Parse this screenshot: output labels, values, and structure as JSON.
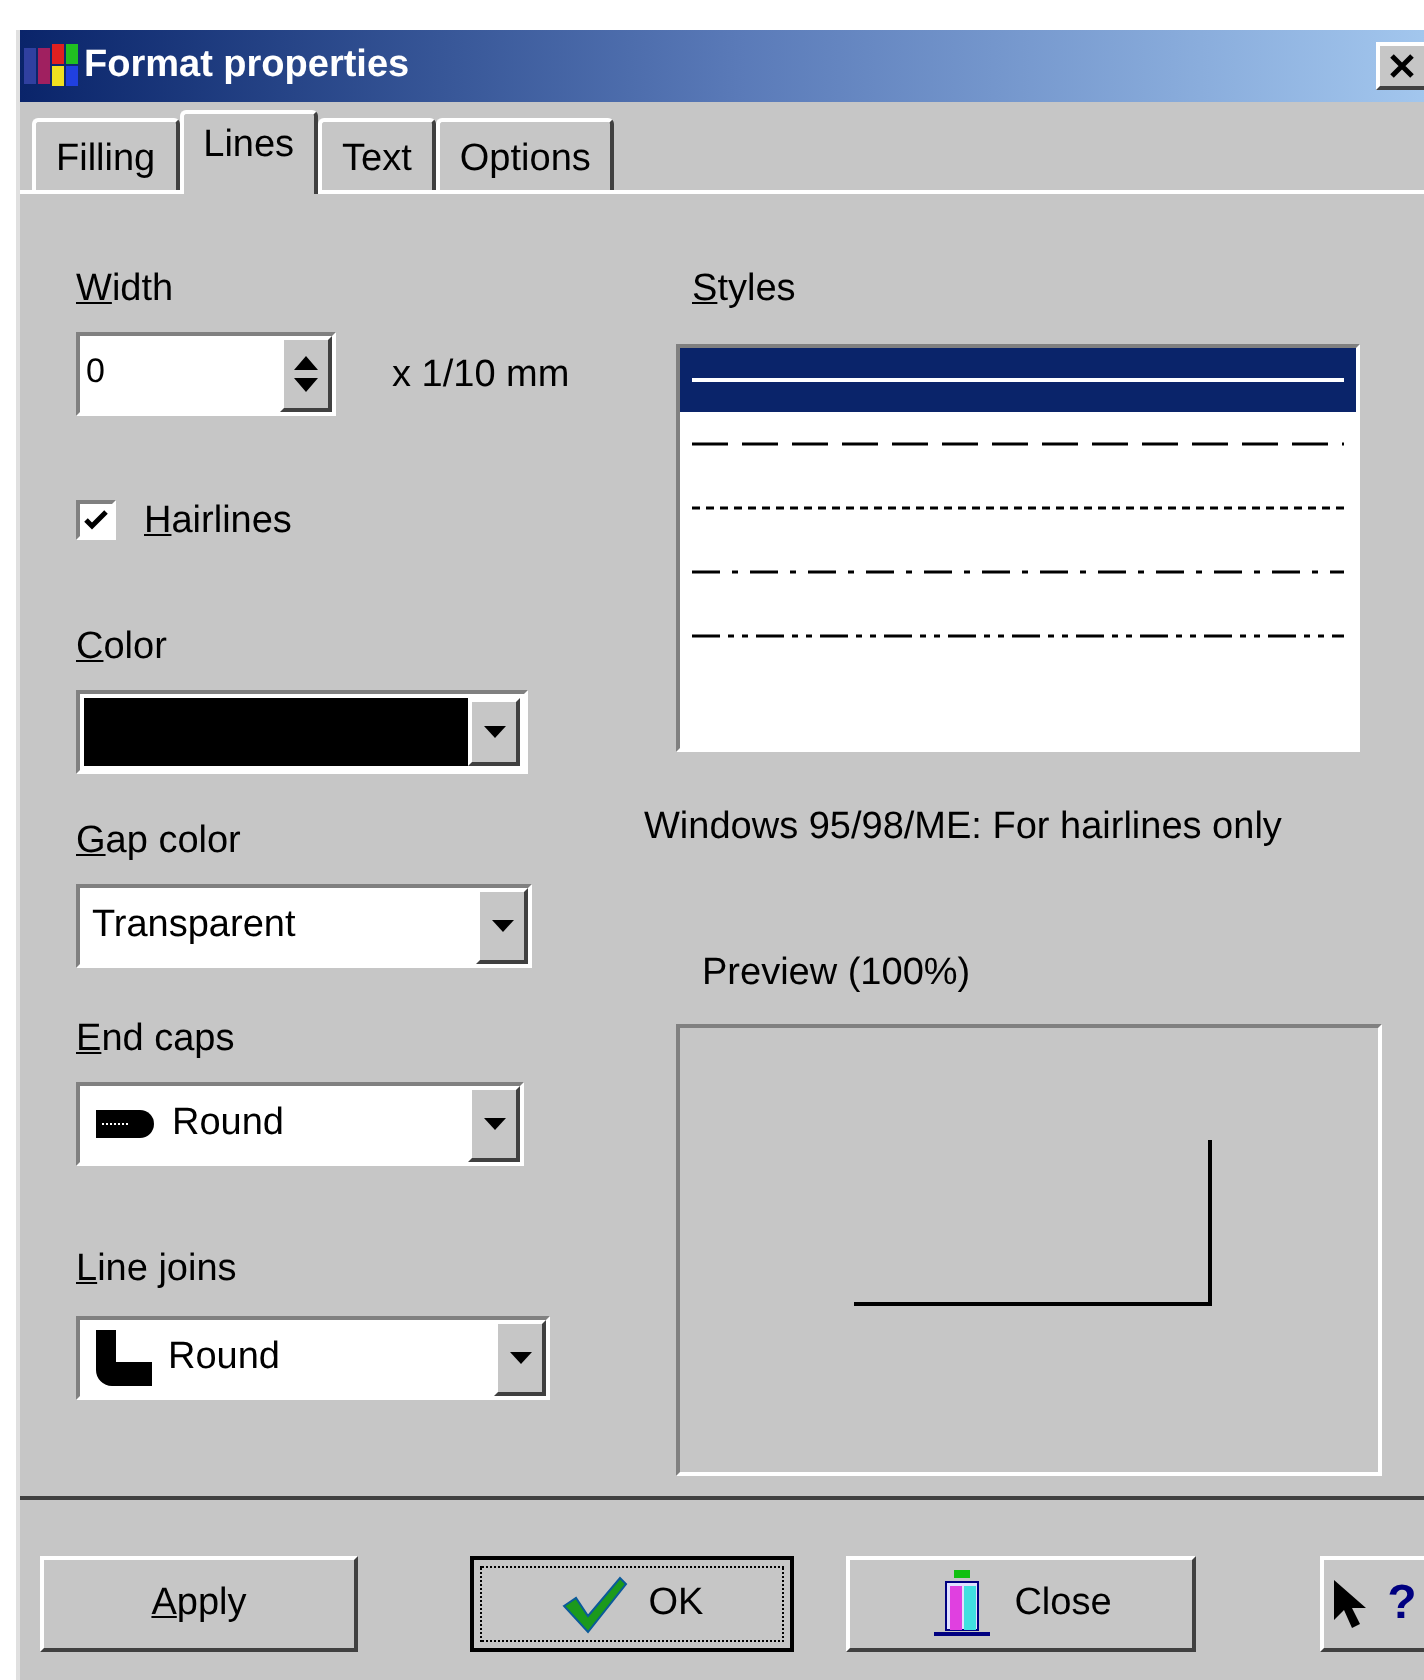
{
  "window": {
    "title": "Format properties"
  },
  "tabs": [
    {
      "label": "Filling",
      "selected": false
    },
    {
      "label": "Lines",
      "selected": true
    },
    {
      "label": "Text",
      "selected": false
    },
    {
      "label": "Options",
      "selected": false
    }
  ],
  "width": {
    "label": "Width",
    "mnemonic": true,
    "value": "0",
    "unit": "x 1/10 mm"
  },
  "hairlines": {
    "label": "Hairlines",
    "mnemonic": true,
    "checked": true
  },
  "color": {
    "label": "Color",
    "mnemonic": true,
    "color": "#000000"
  },
  "gap_color": {
    "label": "Gap color",
    "mnemonic": true,
    "value": "Transparent"
  },
  "end_caps": {
    "label": "End caps",
    "mnemonic": true,
    "value": "Round",
    "kind": "cap"
  },
  "line_joins": {
    "label": "Line joins",
    "mnemonic": true,
    "value": "Round",
    "kind": "join"
  },
  "styles": {
    "label": "Styles",
    "mnemonic": true,
    "items": [
      {
        "kind": "solid",
        "selected": true
      },
      {
        "kind": "dash",
        "selected": false
      },
      {
        "kind": "dot",
        "selected": false
      },
      {
        "kind": "dashdot",
        "selected": false
      },
      {
        "kind": "dashdotdot",
        "selected": false
      }
    ]
  },
  "note": "Windows 95/98/ME: For hairlines only",
  "preview": {
    "label": "Preview (100%)"
  },
  "buttons": [
    {
      "label": "Apply",
      "kind": "apply",
      "mnemonic": true,
      "default": false
    },
    {
      "label": "OK",
      "kind": "ok",
      "mnemonic": false,
      "default": true
    },
    {
      "label": "Close",
      "kind": "close",
      "mnemonic": false,
      "default": false
    },
    {
      "label": "?",
      "kind": "help",
      "mnemonic": false,
      "default": false
    }
  ]
}
